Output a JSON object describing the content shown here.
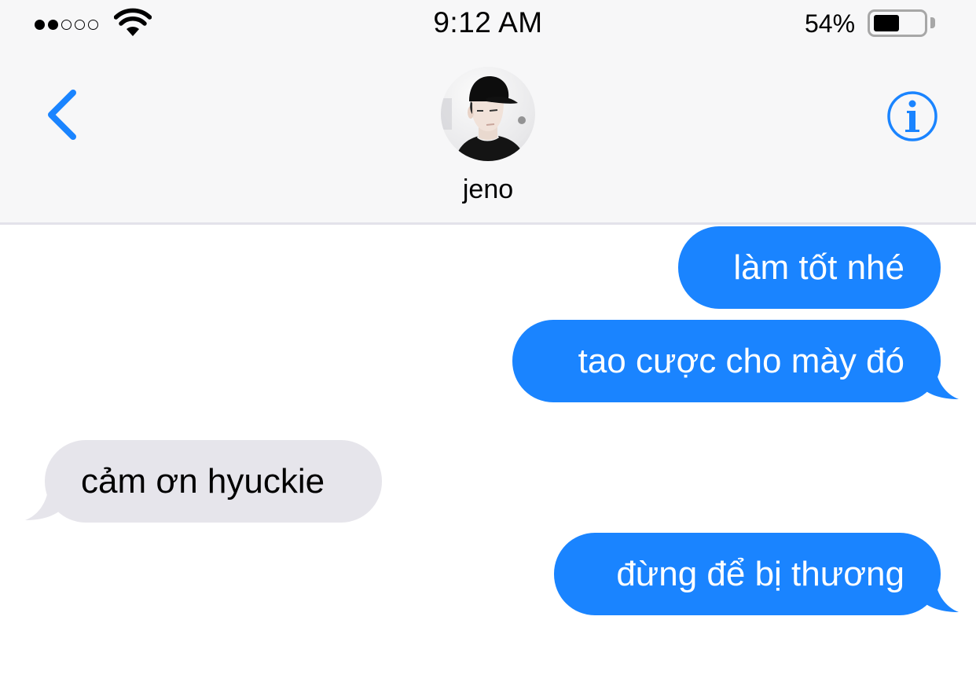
{
  "status_bar": {
    "signal_bars_filled": 2,
    "signal_bars_total": 5,
    "time": "9:12 AM",
    "battery_percent_text": "54%",
    "battery_level": 0.54
  },
  "nav": {
    "back_icon": "chevron-left-icon",
    "contact_name": "jeno",
    "info_icon": "info-icon"
  },
  "messages": [
    {
      "direction": "outgoing",
      "text": "làm tốt nhé"
    },
    {
      "direction": "outgoing",
      "text": "tao cược cho mày đó"
    },
    {
      "direction": "incoming",
      "text": "cảm ơn hyuckie"
    },
    {
      "direction": "outgoing",
      "text": "đừng để bị thương"
    }
  ],
  "colors": {
    "accent": "#1a84ff",
    "outgoing_bubble": "#1a84ff",
    "incoming_bubble": "#e6e5eb",
    "header_bg": "#f7f7f8"
  }
}
